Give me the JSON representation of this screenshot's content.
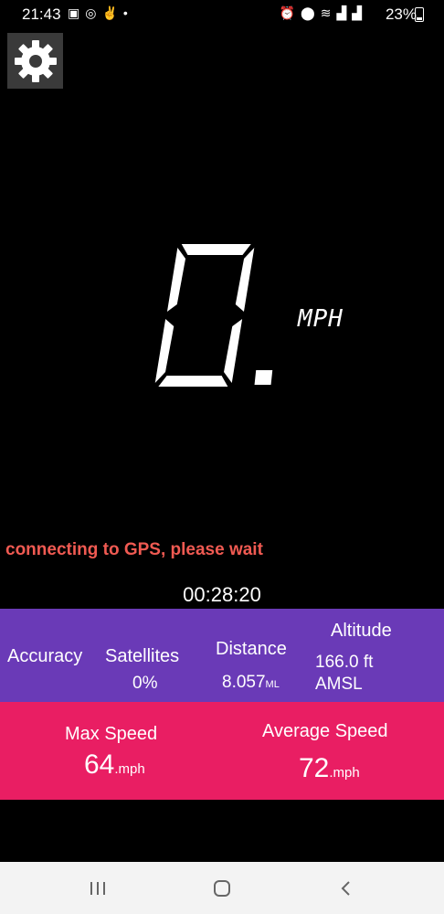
{
  "status_bar": {
    "time": "21:43",
    "battery": "23%",
    "left_icons": [
      "sim-card-icon",
      "whatsapp-icon",
      "app-icon",
      "dot-icon"
    ],
    "right_icons": [
      "alarm-icon",
      "location-icon",
      "wifi-icon",
      "signal-icon",
      "signal-icon"
    ]
  },
  "speed": {
    "value": "0.",
    "unit": "MPH"
  },
  "gps_status": "connecting to GPS, please wait",
  "timer": "00:28:20",
  "info": {
    "accuracy_label": "Accuracy",
    "satellites_label": "Satellites",
    "satellites_value": "0%",
    "distance_label": "Distance",
    "distance_value": "8.057",
    "distance_unit": "ML",
    "altitude_label": "Altitude",
    "altitude_value": "166.0 ft",
    "altitude_ref": "AMSL"
  },
  "speeds": {
    "max_label": "Max Speed",
    "max_value": "64",
    "max_unit": ".mph",
    "avg_label": "Average Speed",
    "avg_value": "72",
    "avg_unit": ".mph"
  },
  "colors": {
    "info_bar": "#6a3ab7",
    "speed_bar": "#e91e63",
    "gps_status": "#f05a52"
  }
}
